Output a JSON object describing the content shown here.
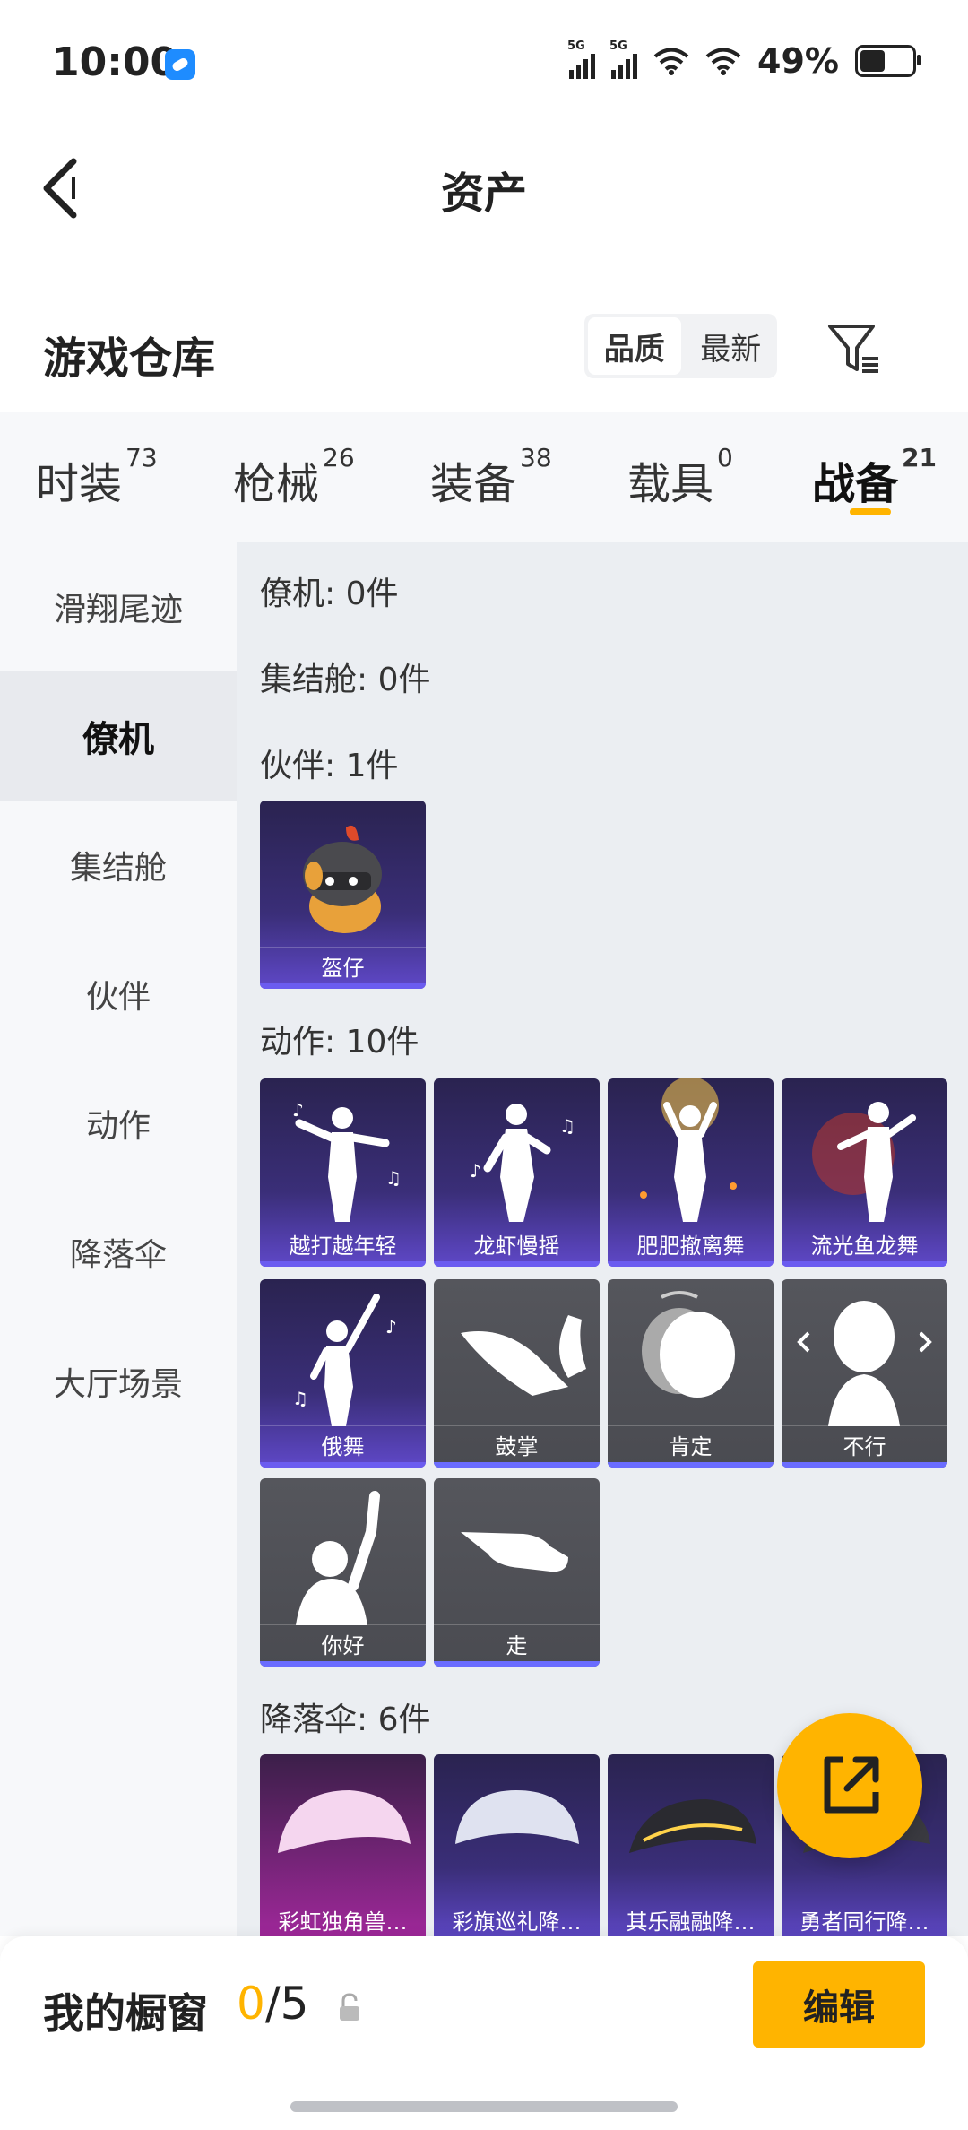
{
  "status": {
    "time": "10:00",
    "signal1": "5G",
    "signal2": "5G",
    "battery": "49%",
    "battery_level": 0.49
  },
  "header": {
    "title": "资产"
  },
  "warehouse": {
    "title": "游戏仓库",
    "sort_options": [
      "品质",
      "最新"
    ],
    "sort_selected": "品质"
  },
  "tabs": [
    {
      "label": "时装",
      "count": "73"
    },
    {
      "label": "枪械",
      "count": "26"
    },
    {
      "label": "装备",
      "count": "38"
    },
    {
      "label": "载具",
      "count": "0"
    },
    {
      "label": "战备",
      "count": "21",
      "active": true
    }
  ],
  "sidebar": [
    {
      "label": "滑翔尾迹"
    },
    {
      "label": "僚机",
      "active": true
    },
    {
      "label": "集结舱"
    },
    {
      "label": "伙伴"
    },
    {
      "label": "动作"
    },
    {
      "label": "降落伞"
    },
    {
      "label": "大厅场景"
    }
  ],
  "sections": [
    {
      "title": "僚机: 0件",
      "items": []
    },
    {
      "title": "集结舱: 0件",
      "items": []
    },
    {
      "title": "伙伴: 1件",
      "items": [
        {
          "name": "盔仔",
          "rarity": "purple",
          "icon": "chick-helmet-icon"
        }
      ]
    },
    {
      "title": "动作: 10件",
      "items": [
        {
          "name": "越打越年轻",
          "rarity": "purple",
          "icon": "dance-music-icon"
        },
        {
          "name": "龙虾慢摇",
          "rarity": "purple",
          "icon": "dance-music-icon"
        },
        {
          "name": "肥肥撤离舞",
          "rarity": "purple",
          "icon": "dance-glow-icon"
        },
        {
          "name": "流光鱼龙舞",
          "rarity": "purple",
          "icon": "dance-fire-icon"
        },
        {
          "name": "俄舞",
          "rarity": "purple",
          "icon": "dance-music-icon"
        },
        {
          "name": "鼓掌",
          "rarity": "gray",
          "icon": "clap-icon"
        },
        {
          "name": "肯定",
          "rarity": "gray",
          "icon": "nod-icon"
        },
        {
          "name": "不行",
          "rarity": "gray",
          "icon": "shake-head-icon"
        },
        {
          "name": "你好",
          "rarity": "gray",
          "icon": "wave-icon"
        },
        {
          "name": "走",
          "rarity": "gray",
          "icon": "point-icon"
        }
      ]
    },
    {
      "title": "降落伞: 6件",
      "items": [
        {
          "name": "彩虹独角兽…",
          "rarity": "pink",
          "icon": "parachute-icon"
        },
        {
          "name": "彩旗巡礼降…",
          "rarity": "purple",
          "icon": "parachute-icon"
        },
        {
          "name": "其乐融融降…",
          "rarity": "purple",
          "icon": "parachute-icon"
        },
        {
          "name": "勇者同行降…",
          "rarity": "purple",
          "icon": "parachute-icon"
        }
      ]
    }
  ],
  "showcase": {
    "label": "我的橱窗",
    "current": "0",
    "total": "/5",
    "edit_label": "编辑"
  },
  "colors": {
    "accent": "#ffb400",
    "purple_card": "#3a2e78",
    "gray_card": "#4a4b51"
  }
}
